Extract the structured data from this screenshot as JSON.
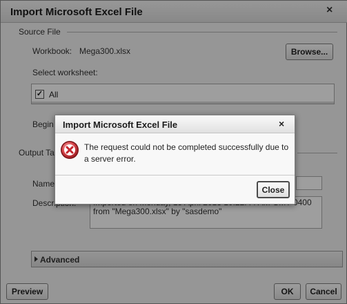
{
  "background_dialog": {
    "title": "Import Microsoft Excel File",
    "close_glyph": "×",
    "source_file": {
      "group_label": "Source File",
      "workbook_label": "Workbook:",
      "workbook_value": "Mega300.xlsx",
      "browse_label": "Browse...",
      "select_worksheet_label": "Select worksheet:",
      "all_label": "All",
      "all_checked": true,
      "begin_label": "Begin"
    },
    "output_table": {
      "group_label": "Output Ta",
      "name_label": "Name",
      "description_label": "Description:",
      "description_value": "Imported on Monday, 15 April 2013 10:22:44 AM GMT-0400\nfrom \"Mega300.xlsx\" by \"sasdemo\""
    },
    "advanced_label": "Advanced",
    "preview_label": "Preview",
    "ok_label": "OK",
    "cancel_label": "Cancel"
  },
  "error_dialog": {
    "title": "Import Microsoft Excel File",
    "close_glyph": "×",
    "icon": "error-x-circle-icon",
    "message": "The request could not be completed successfully due to a server error.",
    "close_label": "Close"
  },
  "colors": {
    "overlay": "#000000",
    "error_icon_red": "#c4262e"
  }
}
